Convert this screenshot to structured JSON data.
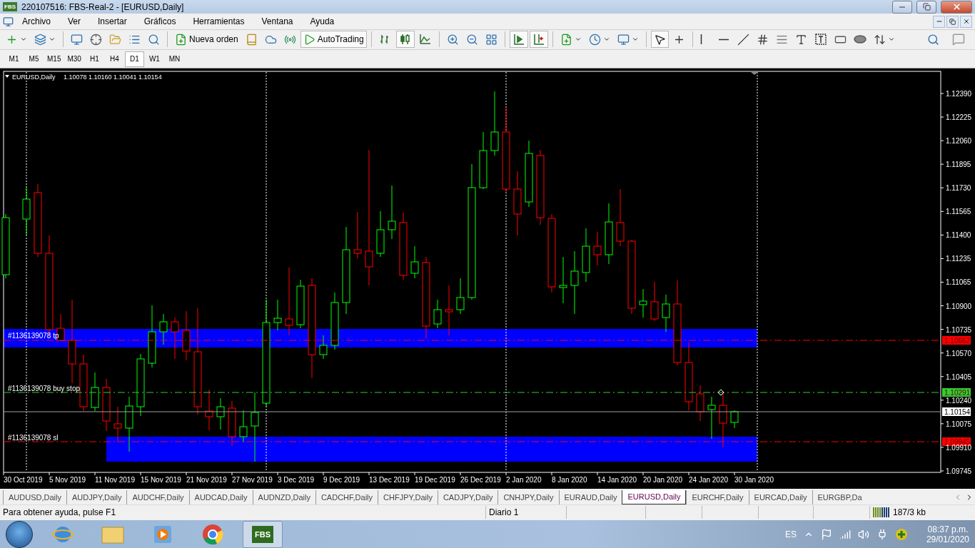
{
  "window": {
    "icon_text": "FBS",
    "title": "220107516: FBS-Real-2 - [EURUSD,Daily]"
  },
  "menu": [
    "Archivo",
    "Ver",
    "Insertar",
    "Gráficos",
    "Herramientas",
    "Ventana",
    "Ayuda"
  ],
  "toolbar": [
    {
      "pressed": false
    },
    {
      "pressed": false
    },
    {
      "pressed": false
    },
    {
      "pressed": false
    },
    {
      "pressed": false
    },
    {
      "pressed": false
    },
    {
      "pressed": false
    },
    {
      "label": "Nueva orden",
      "pressed": false
    },
    {
      "pressed": false
    },
    {
      "pressed": false
    },
    {
      "pressed": false
    },
    {
      "label": "AutoTrading",
      "pressed": true
    },
    {
      "pressed": false
    },
    {
      "pressed": true
    },
    {
      "pressed": false
    },
    {
      "pressed": false
    },
    {
      "pressed": false
    },
    {
      "pressed": false
    },
    {
      "pressed": true
    },
    {
      "pressed": true
    },
    {
      "pressed": false
    },
    {
      "pressed": false
    },
    {
      "pressed": false
    },
    {
      "pressed": true
    },
    {
      "pressed": false
    },
    {
      "pressed": false
    },
    {
      "pressed": false
    },
    {
      "pressed": false
    },
    {
      "pressed": false
    },
    {
      "pressed": false
    },
    {
      "pressed": false
    },
    {
      "pressed": false
    },
    {
      "pressed": false
    },
    {
      "pressed": false
    },
    {
      "pressed": false
    }
  ],
  "timeframes": [
    {
      "label": "M1",
      "selected": false
    },
    {
      "label": "M5",
      "selected": false
    },
    {
      "label": "M15",
      "selected": false
    },
    {
      "label": "M30",
      "selected": false
    },
    {
      "label": "H1",
      "selected": false
    },
    {
      "label": "H4",
      "selected": false
    },
    {
      "label": "D1",
      "selected": true
    },
    {
      "label": "W1",
      "selected": false
    },
    {
      "label": "MN",
      "selected": false
    }
  ],
  "chart": {
    "symbol": "EURUSD,Daily",
    "ohlc": "1.10078 1.10160 1.10041 1.10154",
    "price_ticks": [
      "1.12390",
      "1.12225",
      "1.12060",
      "1.11895",
      "1.11730",
      "1.11565",
      "1.11400",
      "1.11235",
      "1.11065",
      "1.10900",
      "1.10735",
      "1.10570",
      "1.10405",
      "1.10240",
      "1.10075",
      "1.09910",
      "1.09745"
    ],
    "date_labels": [
      "30 Oct 2019",
      "5 Nov 2019",
      "11 Nov 2019",
      "15 Nov 2019",
      "21 Nov 2019",
      "27 Nov 2019",
      "3 Dec 2019",
      "9 Dec 2019",
      "13 Dec 2019",
      "19 Dec 2019",
      "26 Dec 2019",
      "2 Jan 2020",
      "8 Jan 2020",
      "14 Jan 2020",
      "20 Jan 2020",
      "24 Jan 2020",
      "30 Jan 2020"
    ],
    "price_lines": [
      {
        "kind": "order",
        "label": "#1136139078 tp",
        "tag": "1.10662",
        "color": "#ff0000"
      },
      {
        "kind": "order",
        "label": "#1136139078 buy stop",
        "tag": "1.10291",
        "color": "#32cd32"
      },
      {
        "kind": "bid",
        "tag": "1.10154",
        "color": "#ffffff"
      },
      {
        "kind": "order",
        "label": "#1136139078 sl",
        "tag": "1.09945",
        "color": "#ff0000"
      }
    ]
  },
  "tabs": [
    {
      "label": "AUDUSD,Daily",
      "selected": false
    },
    {
      "label": "AUDJPY,Daily",
      "selected": false
    },
    {
      "label": "AUDCHF,Daily",
      "selected": false
    },
    {
      "label": "AUDCAD,Daily",
      "selected": false
    },
    {
      "label": "AUDNZD,Daily",
      "selected": false
    },
    {
      "label": "CADCHF,Daily",
      "selected": false
    },
    {
      "label": "CHFJPY,Daily",
      "selected": false
    },
    {
      "label": "CADJPY,Daily",
      "selected": false
    },
    {
      "label": "CNHJPY,Daily",
      "selected": false
    },
    {
      "label": "EURAUD,Daily",
      "selected": false
    },
    {
      "label": "EURUSD,Daily",
      "selected": true
    },
    {
      "label": "EURCHF,Daily",
      "selected": false
    },
    {
      "label": "EURCAD,Daily",
      "selected": false
    },
    {
      "label": "EURGBP,Da",
      "selected": false
    }
  ],
  "status_bar": {
    "help": "Para obtener ayuda, pulse F1",
    "profile": "Diario 1",
    "traffic": "187/3 kb"
  },
  "taskbar": {
    "apps": [
      {
        "selected": false
      },
      {
        "selected": false
      },
      {
        "selected": false
      },
      {
        "selected": false
      },
      {
        "label": "FBS",
        "selected": true
      }
    ],
    "language": "ES",
    "time": "08:37 p.m.",
    "date": "29/01/2020"
  }
}
